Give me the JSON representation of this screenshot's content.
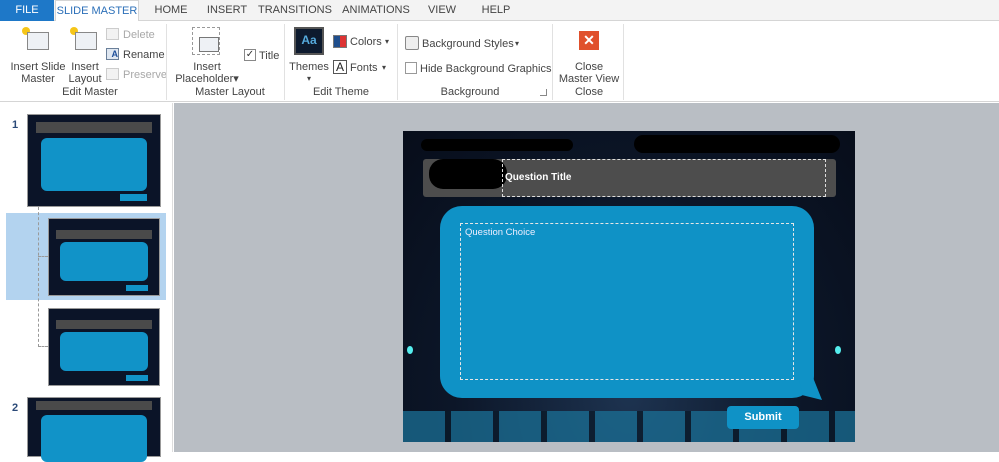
{
  "tabs": [
    "FILE",
    "SLIDE MASTER",
    "HOME",
    "INSERT",
    "TRANSITIONS",
    "ANIMATIONS",
    "VIEW",
    "HELP"
  ],
  "ribbon": {
    "edit_master": {
      "label": "Edit Master",
      "insert_slide_master": [
        "Insert Slide",
        "Master"
      ],
      "insert_layout": [
        "Insert",
        "Layout"
      ],
      "delete": "Delete",
      "rename": "Rename",
      "preserve": "Preserve"
    },
    "master_layout": {
      "label": "Master Layout",
      "insert_placeholder": [
        "Insert",
        "Placeholder"
      ],
      "title": "Title",
      "title_checked": true
    },
    "edit_theme": {
      "label": "Edit Theme",
      "themes": "Themes",
      "colors": "Colors",
      "fonts": "Fonts"
    },
    "background": {
      "label": "Background",
      "background_styles": "Background Styles",
      "hide_background_graphics": "Hide Background Graphics",
      "hide_checked": false
    },
    "close": {
      "label": "Close",
      "close_master_view": [
        "Close",
        "Master View"
      ]
    }
  },
  "thumbnails": {
    "slide1_number": "1",
    "slide2_number": "2"
  },
  "slide": {
    "question_title": "Question Title",
    "question_choice": "Question Choice",
    "submit": "Submit"
  },
  "colors": {
    "accent": "#1e78c8",
    "bubble": "#0f92c6",
    "close_red": "#e0502c"
  }
}
